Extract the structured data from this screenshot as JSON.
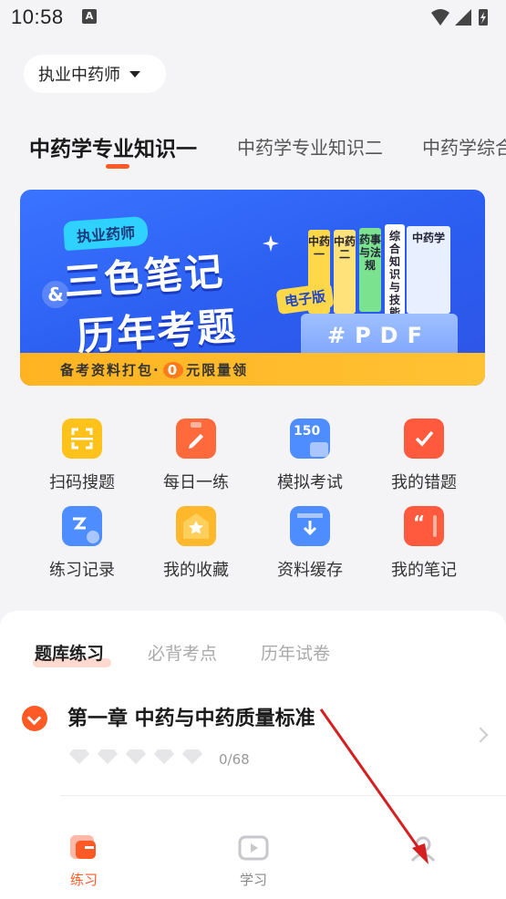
{
  "status_bar": {
    "time": "10:58"
  },
  "exam_selector": {
    "label": "执业中药师"
  },
  "subject_tabs": [
    {
      "label": "中药学专业知识一",
      "active": true
    },
    {
      "label": "中药学专业知识二",
      "active": false
    },
    {
      "label": "中药学综合",
      "active": false
    }
  ],
  "banner": {
    "badge": "执业药师",
    "title_line1": "三色笔记",
    "title_line2": "历年考题",
    "amp": "&",
    "ebook_badge": "电子版",
    "books": [
      "中药一",
      "中药二",
      "药事与法规",
      "综合知识与技能",
      "中药学"
    ],
    "pdf_label": "#PDF",
    "footer_prefix": "备考资料打包·",
    "footer_zero": "0",
    "footer_suffix": "元限量领"
  },
  "features": [
    {
      "label": "扫码搜题",
      "icon": "scan-icon"
    },
    {
      "label": "每日一练",
      "icon": "daily-practice-icon"
    },
    {
      "label": "模拟考试",
      "icon": "mock-exam-icon",
      "icon_text": "150"
    },
    {
      "label": "我的错题",
      "icon": "wrong-questions-icon"
    },
    {
      "label": "练习记录",
      "icon": "practice-record-icon"
    },
    {
      "label": "我的收藏",
      "icon": "favorites-icon"
    },
    {
      "label": "资料缓存",
      "icon": "download-cache-icon"
    },
    {
      "label": "我的笔记",
      "icon": "notes-icon"
    }
  ],
  "practice_tabs": [
    {
      "label": "题库练习",
      "active": true
    },
    {
      "label": "必背考点",
      "active": false
    },
    {
      "label": "历年试卷",
      "active": false
    }
  ],
  "chapter": {
    "title": "第一章 中药与中药质量标准",
    "progress": "0/68",
    "gems_total": 5,
    "gems_filled": 0
  },
  "bottom_nav": [
    {
      "label": "练习",
      "icon": "practice-nav-icon",
      "active": true
    },
    {
      "label": "学习",
      "icon": "study-nav-icon",
      "active": false
    },
    {
      "label": "",
      "icon": "profile-nav-icon",
      "active": false
    }
  ],
  "colors": {
    "accent": "#ff5a26",
    "banner_blue": "#2f5ff0",
    "banner_footer": "#ffb322"
  }
}
